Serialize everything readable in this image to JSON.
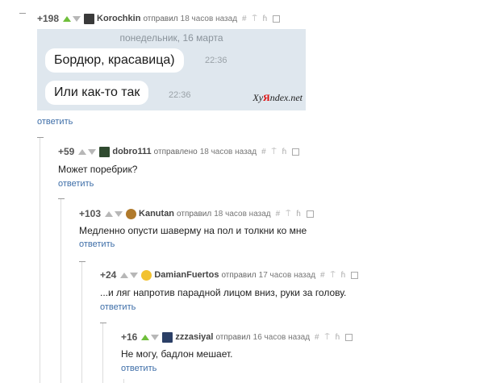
{
  "colors": {
    "vote_up_active": "#6fbf3b",
    "vote_inactive": "#b7b7b7",
    "reply_link": "#3e6ea8",
    "chat_bg": "#dfe7ee"
  },
  "icons": {
    "vote_up": "triangle-up",
    "vote_down": "triangle-down",
    "link": "#",
    "pin": "pin",
    "branch": "branch",
    "save": "floppy"
  },
  "comments": [
    {
      "rating": "+198",
      "username": "Korochkin",
      "action": "отправил",
      "time": "18 часов назад",
      "reply": "ответить",
      "chat": {
        "date": "понедельник, 16 марта",
        "messages": [
          {
            "text": "Бордюр, красавица)",
            "time": "22:36"
          },
          {
            "text": "Или как-то так",
            "time": "22:36"
          }
        ],
        "watermark_a": "Xy",
        "watermark_b": "Я",
        "watermark_c": "ndex.net"
      }
    },
    {
      "rating": "+59",
      "username": "dobro111",
      "action": "отправлено",
      "time": "18 часов назад",
      "text": "Может поребрик?",
      "reply": "ответить"
    },
    {
      "rating": "+103",
      "username": "Kanutan",
      "action": "отправил",
      "time": "18 часов назад",
      "text": "Медленно опусти шаверму на пол и толкни ко мне",
      "reply": "ответить"
    },
    {
      "rating": "+24",
      "username": "DamianFuertos",
      "action": "отправил",
      "time": "17 часов назад",
      "text": "...и ляг напротив парадной лицом вниз, руки за голову.",
      "reply": "ответить"
    },
    {
      "rating": "+16",
      "username": "zzzasiyal",
      "action": "отправил",
      "time": "16 часов назад",
      "text": "Не могу, бадлон мешает.",
      "reply": "ответить"
    }
  ]
}
